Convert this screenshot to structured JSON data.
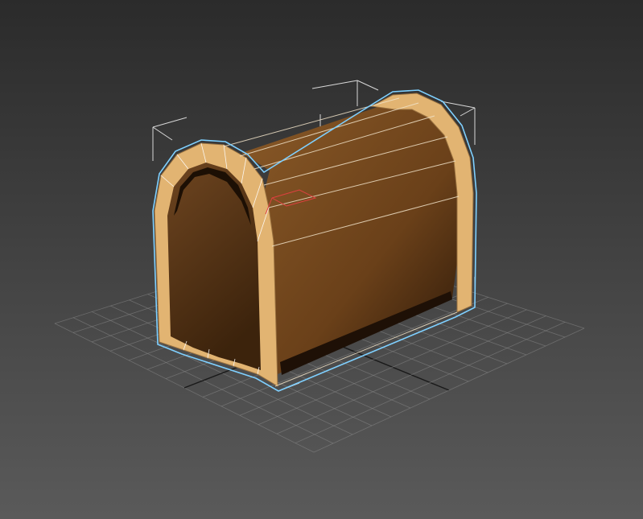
{
  "viewport": {
    "background_top": "#2b2b2b",
    "background_bottom": "#555555",
    "grid_color": "#8a8a8a",
    "grid_axis_color": "#141414"
  },
  "object": {
    "name": "chest",
    "selected": true,
    "body_color_light": "#8a5a28",
    "body_color_dark": "#3a220c",
    "trim_color": "#e6b877",
    "trim_dark": "#b8894e",
    "wire_color": "#ffffff",
    "selection_outline_color": "#7fd0ff"
  },
  "bounding_box": {
    "color": "#d8d8d8"
  },
  "pivot": {
    "color": "#e04040"
  }
}
